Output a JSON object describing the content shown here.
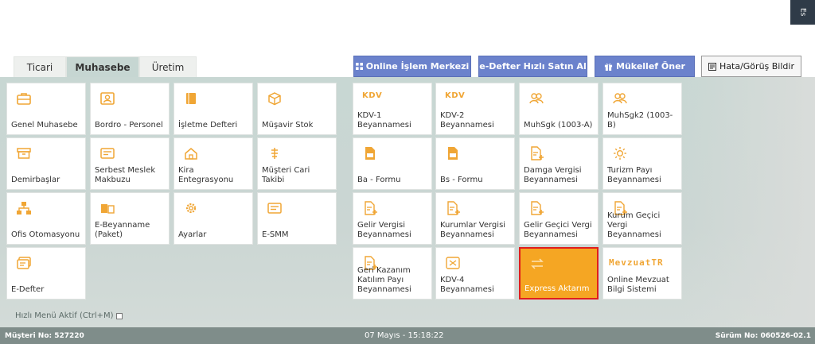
{
  "corner_label": "Es",
  "tabs": [
    {
      "label": "Ticari"
    },
    {
      "label": "Muhasebe",
      "active": true
    },
    {
      "label": "Üretim"
    }
  ],
  "actions": {
    "online": "Online İşlem Merkezi",
    "edefter": "e-Defter Hızlı Satın Al",
    "mukellef": "Mükellef Öner",
    "hata": "Hata/Görüş Bildir"
  },
  "tiles_left": [
    {
      "label": "Genel Muhasebe",
      "icon": "briefcase-icon"
    },
    {
      "label": "Bordro - Personel",
      "icon": "person-card-icon"
    },
    {
      "label": "İşletme Defteri",
      "icon": "book-icon"
    },
    {
      "label": "Müşavir Stok",
      "icon": "box-icon"
    },
    {
      "label": "Demirbaşlar",
      "icon": "archive-icon"
    },
    {
      "label": "Serbest Meslek Makbuzu",
      "icon": "receipt-icon"
    },
    {
      "label": "Kira Entegrasyonu",
      "icon": "home-icon"
    },
    {
      "label": "Müşteri Cari Takibi",
      "icon": "scale-icon"
    },
    {
      "label": "Ofis Otomasyonu",
      "icon": "org-chart-icon"
    },
    {
      "label": "E-Beyanname (Paket)",
      "icon": "package-icon"
    },
    {
      "label": "Ayarlar",
      "icon": "gear-icon"
    },
    {
      "label": "E-SMM",
      "icon": "document-icon"
    },
    {
      "label": "E-Defter",
      "icon": "ledger-icon"
    }
  ],
  "tiles_right": [
    {
      "label": "KDV-1 Beyannamesi",
      "logo": "KDV"
    },
    {
      "label": "KDV-2 Beyannamesi",
      "logo": "KDV"
    },
    {
      "label": "MuhSgk (1003-A)",
      "icon": "users-icon"
    },
    {
      "label": "MuhSgk2 (1003-B)",
      "icon": "users-icon"
    },
    {
      "label": "Ba - Formu",
      "icon": "form-icon"
    },
    {
      "label": "Bs - Formu",
      "icon": "form-icon"
    },
    {
      "label": "Damga Vergisi Beyannamesi",
      "icon": "doc-plus-icon"
    },
    {
      "label": "Turizm Payı Beyannamesi",
      "icon": "sun-icon"
    },
    {
      "label": "Gelir Vergisi Beyannamesi",
      "icon": "doc-plus-icon"
    },
    {
      "label": "Kurumlar Vergisi Beyannamesi",
      "icon": "doc-plus-icon"
    },
    {
      "label": "Gelir Geçici Vergi Beyannamesi",
      "icon": "doc-plus-icon"
    },
    {
      "label": "Kurum Geçici Vergi Beyannamesi",
      "icon": "doc-plus-icon"
    },
    {
      "label": "Geri Kazanım Katılım Payı Beyannamesi",
      "icon": "doc-plus-icon"
    },
    {
      "label": "KDV-4 Beyannamesi",
      "icon": "stamp-icon"
    },
    {
      "label": "Express Aktarım",
      "icon": "transfer-icon",
      "highlighted": true
    },
    {
      "label": "Online Mevzuat Bilgi Sistemi",
      "logo": "MevzuatTR"
    }
  ],
  "hizli_menu": "Hızlı Menü Aktif (Ctrl+M)",
  "status": {
    "musteri": "Müşteri No: 527220",
    "datetime": "07 Mayıs - 15:18:22",
    "surum": "Sürüm No: 060526-02.1"
  },
  "colors": {
    "accent": "#f0a635",
    "button_blue": "#6b82cc",
    "highlight_border": "#e01e1e",
    "status_bar": "#7f8d8a"
  }
}
